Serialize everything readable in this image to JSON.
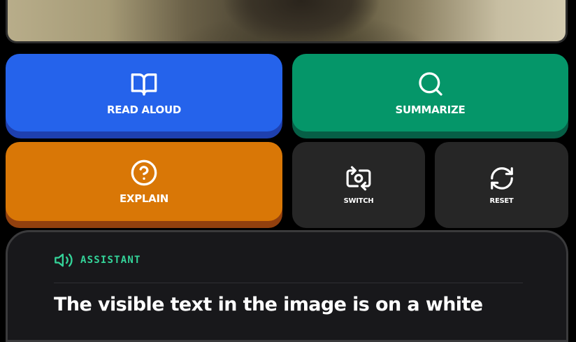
{
  "buttons": {
    "read_aloud": "READ ALOUD",
    "summarize": "SUMMARIZE",
    "explain": "EXPLAIN",
    "switch": "SWITCH",
    "reset": "RESET"
  },
  "assistant": {
    "label": "ASSISTANT",
    "message": "The visible text in the image is on a white"
  },
  "icons": {
    "read_aloud": "book-open-icon",
    "summarize": "search-icon",
    "explain": "help-circle-icon",
    "switch": "switch-camera-icon",
    "reset": "refresh-icon",
    "assistant": "speaker-icon"
  },
  "colors": {
    "read_aloud": "#2563eb",
    "summarize": "#059669",
    "explain": "#d97706",
    "tile": "#262626",
    "assistant_accent": "#34d399"
  }
}
